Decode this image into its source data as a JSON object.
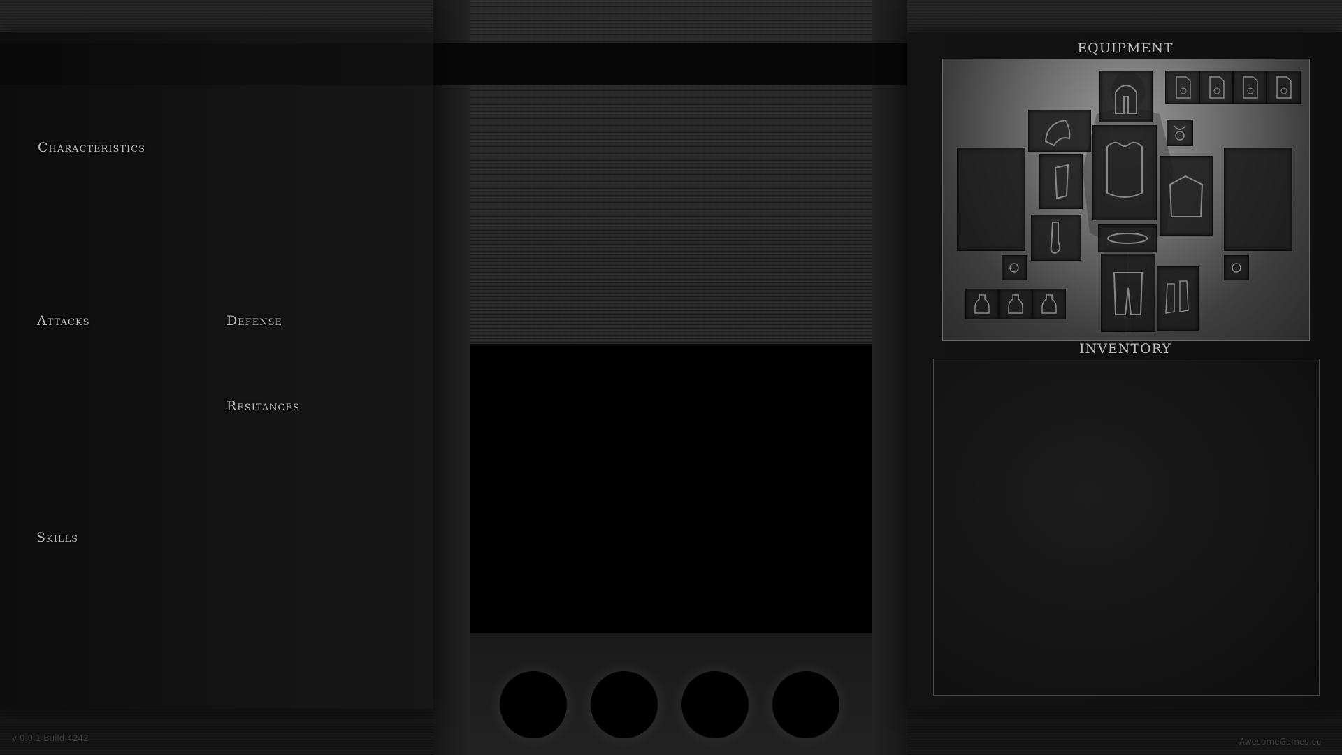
{
  "sections": {
    "characteristics": "Characteristics",
    "attacks": "Attacks",
    "defense": "Defense",
    "resistances": "Resitances",
    "skills": "Skills"
  },
  "equipment": {
    "title": "EQUIPMENT",
    "slots": [
      "helmet-icon",
      "shoulder-icon",
      "amulet-icon",
      "chest-armor-icon",
      "bracer-icon",
      "cape-icon",
      "glove-icon",
      "belt-icon",
      "leggings-icon",
      "boots-icon",
      "ring-icon",
      "ring-icon",
      "scroll-icon",
      "scroll-icon",
      "scroll-icon",
      "scroll-icon",
      "potion-icon",
      "potion-icon",
      "potion-icon"
    ]
  },
  "inventory": {
    "title": "INVENTORY"
  },
  "footer": {
    "version": "v 0.0.1 Build 4242",
    "studio": "AwesomeGames.co"
  },
  "colors": {
    "text": "#bdbdbd",
    "background": "#1c1c1c",
    "portrait": "#000000"
  }
}
